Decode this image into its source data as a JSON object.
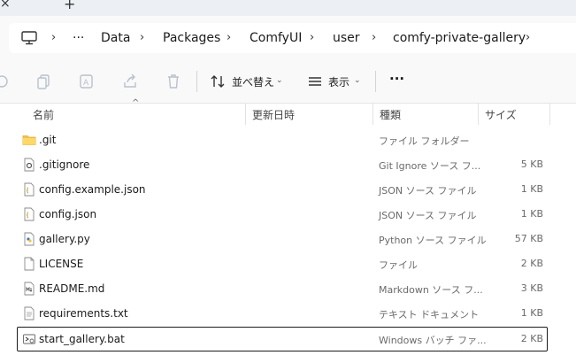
{
  "tabs": {
    "close_glyph": "×",
    "add_glyph": "+"
  },
  "breadcrumb": {
    "more": "···",
    "items": [
      "Data",
      "Packages",
      "ComfyUI",
      "user",
      "comfy-private-gallery"
    ],
    "sep": "›"
  },
  "command_bar": {
    "sort_label": "並べ替え",
    "view_label": "表示",
    "more_glyph": "···",
    "chevron": "⌄"
  },
  "columns": {
    "name": "名前",
    "modified": "更新日時",
    "type": "種類",
    "size": "サイズ",
    "sort_indicator": "^"
  },
  "files": [
    {
      "name": ".git",
      "type": "ファイル フォルダー",
      "size": "",
      "icon": "folder-icon"
    },
    {
      "name": ".gitignore",
      "type": "Git Ignore ソース フ...",
      "size": "5 KB",
      "icon": "gear-file-icon"
    },
    {
      "name": "config.example.json",
      "type": "JSON ソース ファイル",
      "size": "1 KB",
      "icon": "json-file-icon"
    },
    {
      "name": "config.json",
      "type": "JSON ソース ファイル",
      "size": "1 KB",
      "icon": "json-file-icon"
    },
    {
      "name": "gallery.py",
      "type": "Python ソース ファイル",
      "size": "57 KB",
      "icon": "python-file-icon"
    },
    {
      "name": "LICENSE",
      "type": "ファイル",
      "size": "2 KB",
      "icon": "blank-file-icon"
    },
    {
      "name": "README.md",
      "type": "Markdown ソース フ...",
      "size": "3 KB",
      "icon": "markdown-file-icon"
    },
    {
      "name": "requirements.txt",
      "type": "テキスト ドキュメント",
      "size": "1 KB",
      "icon": "text-file-icon"
    },
    {
      "name": "start_gallery.bat",
      "type": "Windows バッチ ファ...",
      "size": "2 KB",
      "icon": "batch-file-icon",
      "selected": true
    }
  ]
}
